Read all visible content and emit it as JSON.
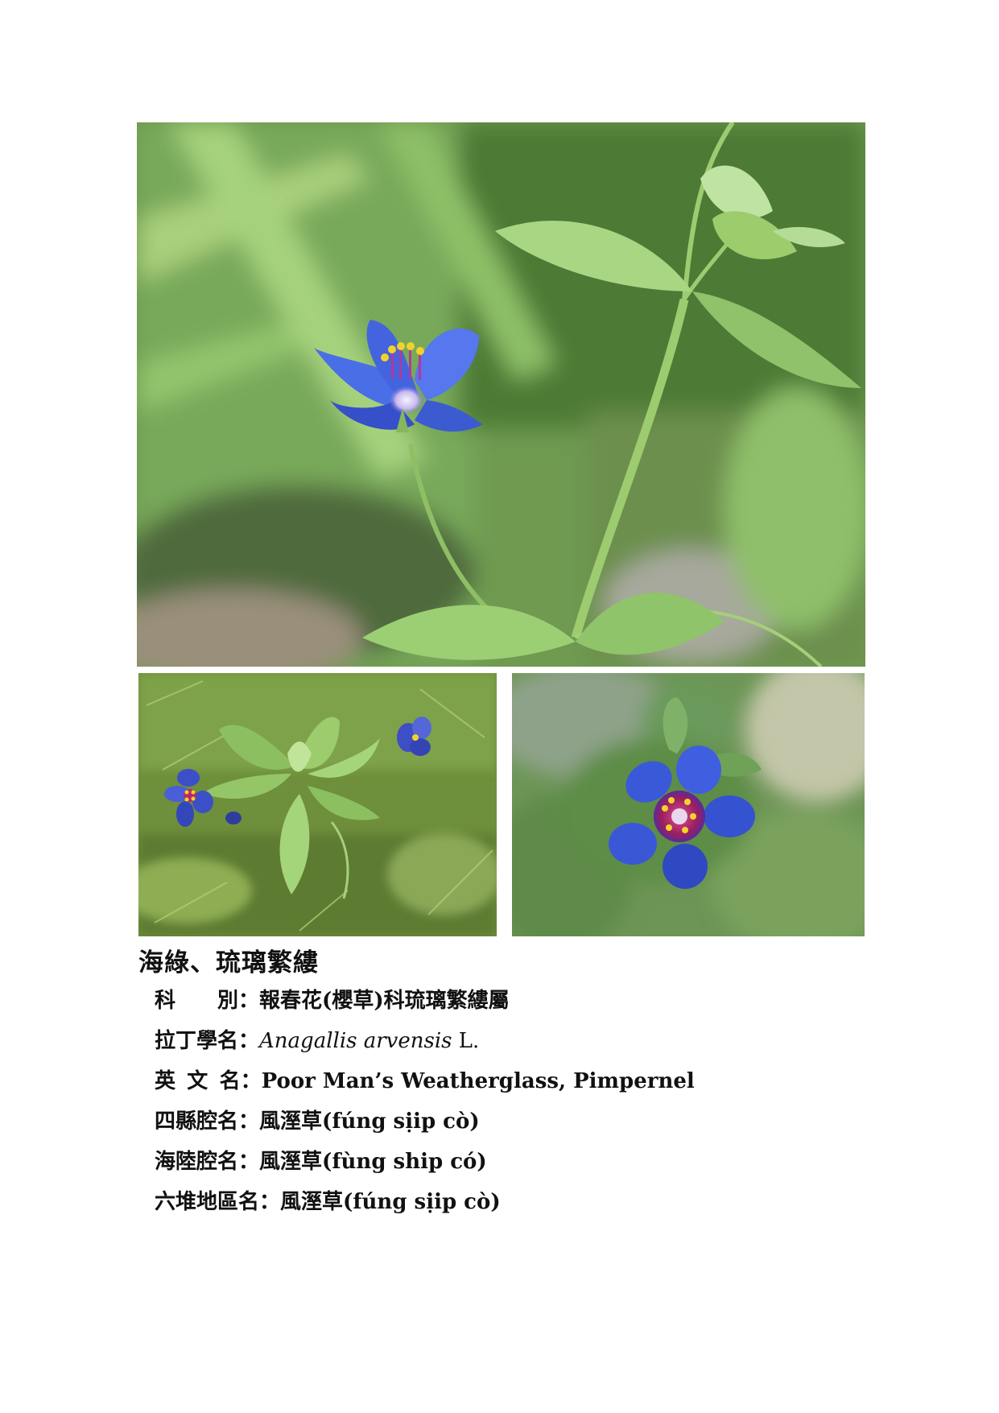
{
  "title": "海綠、琉璃繁縷",
  "info": {
    "family": {
      "label": "科　　別",
      "value": "報春花(櫻草)科琉璃繁縷屬"
    },
    "latin": {
      "label": "拉丁學名",
      "value_italic": "Anagallis arvensis",
      "value_author": " L."
    },
    "english": {
      "label": "英文名",
      "value": "Poor Man’s Weatherglass, Pimpernel"
    },
    "sixian": {
      "label": "四縣腔名",
      "value": "風溼草(fúng sịip cò)"
    },
    "hailu": {
      "label": "海陸腔名",
      "value": "風溼草(fùng ship có)"
    },
    "liudui": {
      "label": "六堆地區名",
      "value": "風溼草(fúng sịip cò)"
    }
  },
  "separator": "：",
  "photos": {
    "main": {
      "subject": "blue-pimpernel-flower-with-stem"
    },
    "bottom_left": {
      "subject": "pimpernel-plant-top-view"
    },
    "bottom_right": {
      "subject": "pimpernel-flower-closeup"
    }
  },
  "colors": {
    "petal_blue": "#3f5fd6",
    "petal_dark": "#2c3fb0",
    "center_magenta": "#b0246a",
    "leaf_green": "#7fb85a",
    "background_green": "#5e8a45"
  }
}
